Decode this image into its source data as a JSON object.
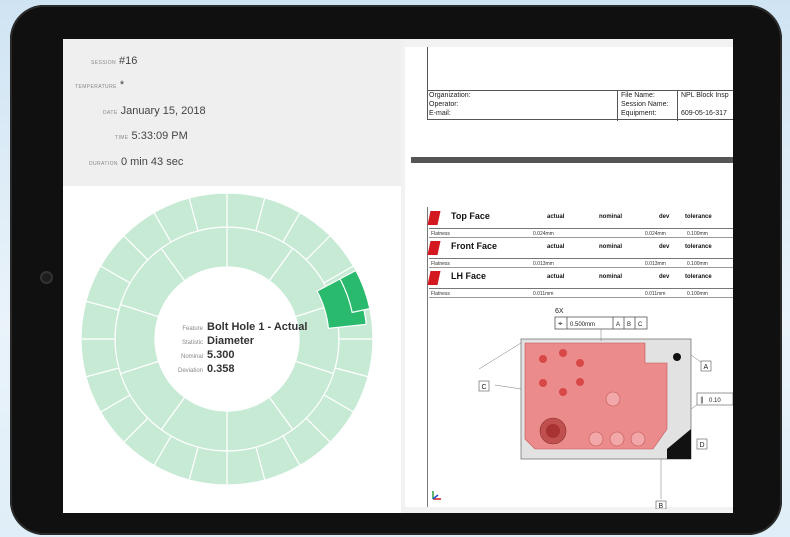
{
  "session": {
    "session_label": "SESSION",
    "session_value": "#16",
    "temperature_label": "TEMPERATURE",
    "temperature_value": "*",
    "date_label": "DATE",
    "date_value": "January 15, 2018",
    "time_label": "TIME",
    "time_value": "5:33:09 PM",
    "duration_label": "DURATION",
    "duration_value": "0 min 43 sec"
  },
  "donut_center": {
    "feature_label": "Feature",
    "feature_value": "Bolt Hole 1 - Actual",
    "statistic_label": "Statistic",
    "statistic_value": "Diameter",
    "nominal_label": "Nominal",
    "nominal_value": "5.300",
    "deviation_label": "Deviation",
    "deviation_value": "0.358"
  },
  "colors": {
    "donut_light": "#c6ead4",
    "donut_dark": "#2aba6e",
    "red_flag": "#d4181f",
    "part_fill": "#ec8b8b"
  },
  "report": {
    "organization": "Organization:",
    "operator": "Operator:",
    "email": "E-mail:",
    "file_name_label": "File Name:",
    "session_name_label": "Session Name:",
    "equipment_label": "Equipment:",
    "file_name_value": "NPL Block Insp",
    "equipment_value": "609-05-16-317",
    "col_actual": "actual",
    "col_nominal": "nominal",
    "col_dev": "dev",
    "col_tolerance": "tolerance",
    "features": [
      {
        "name": "Top Face",
        "stat": "Flatness",
        "actual": "0.024mm",
        "dev": "0.024mm",
        "tol": "0.100mm"
      },
      {
        "name": "Front Face",
        "stat": "Flatness",
        "actual": "0.013mm",
        "dev": "0.013mm",
        "tol": "0.100mm"
      },
      {
        "name": "LH Face",
        "stat": "Flatness",
        "actual": "0.011mm",
        "dev": "0.011mm",
        "tol": "0.100mm"
      }
    ],
    "drawing": {
      "count_label": "6X",
      "fcf_tol": "0.500mm",
      "datum_a": "A",
      "datum_b": "B",
      "datum_c": "C",
      "datum_d": "D",
      "side_tol": "0.10"
    }
  }
}
